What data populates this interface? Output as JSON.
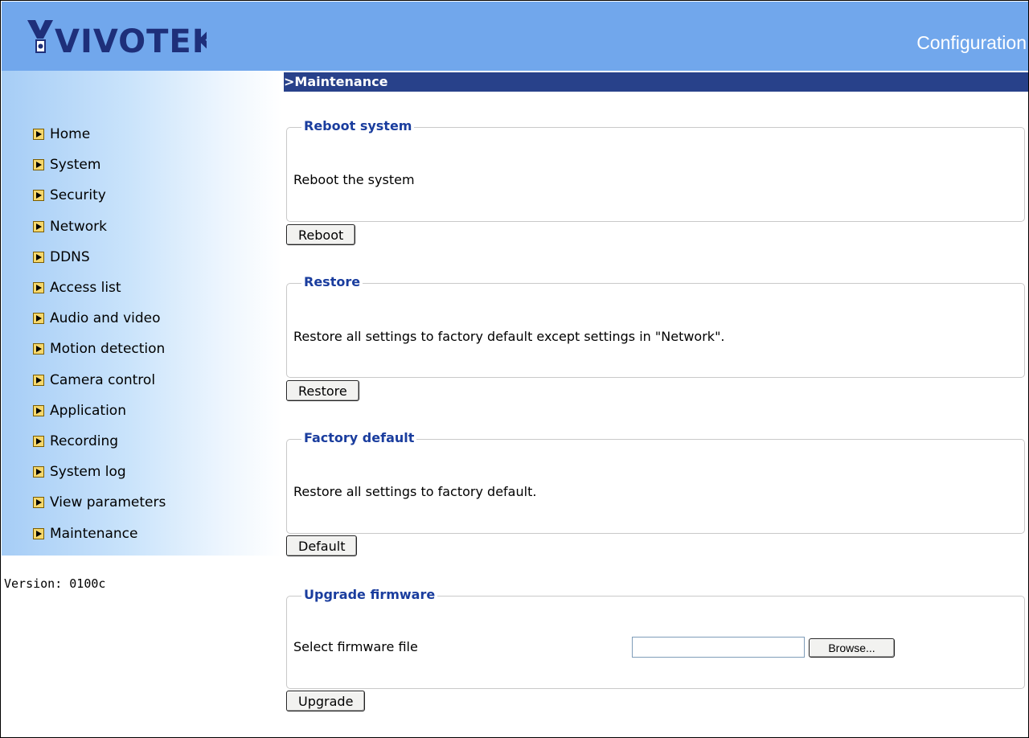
{
  "header": {
    "logo_text": "VIVOTEK",
    "title": "Configuration"
  },
  "sidebar": {
    "items": [
      {
        "label": "Home"
      },
      {
        "label": "System"
      },
      {
        "label": "Security"
      },
      {
        "label": "Network"
      },
      {
        "label": "DDNS"
      },
      {
        "label": "Access list"
      },
      {
        "label": "Audio and video"
      },
      {
        "label": "Motion detection"
      },
      {
        "label": "Camera control"
      },
      {
        "label": "Application"
      },
      {
        "label": "Recording"
      },
      {
        "label": "System log"
      },
      {
        "label": "View parameters"
      },
      {
        "label": "Maintenance"
      }
    ],
    "version": "Version: 0100c"
  },
  "main": {
    "section_title": ">Maintenance",
    "reboot": {
      "legend": "Reboot system",
      "description": "Reboot the system",
      "button": "Reboot"
    },
    "restore": {
      "legend": "Restore",
      "description": "Restore all settings to factory default except settings in \"Network\".",
      "button": "Restore"
    },
    "factory": {
      "legend": "Factory default",
      "description": "Restore all settings to factory default.",
      "button": "Default"
    },
    "upgrade": {
      "legend": "Upgrade firmware",
      "label": "Select firmware file",
      "file_value": "",
      "browse_button": "Browse...",
      "button": "Upgrade"
    }
  },
  "colors": {
    "header_bg": "#71a7ec",
    "section_bar": "#28418a",
    "legend_text": "#1a3d9e"
  }
}
